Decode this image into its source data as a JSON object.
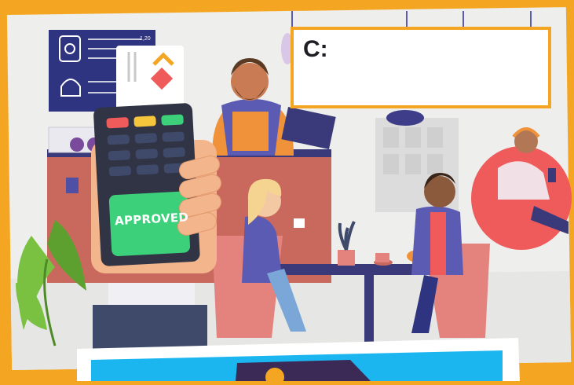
{
  "question_card": {
    "label": "C:"
  },
  "menu_board": {
    "price": "1,20"
  },
  "pos_terminal": {
    "status_text": "APPROVED"
  },
  "colors": {
    "frame": "#f4a623",
    "background": "#eeeeec",
    "counter": "#c9695e",
    "approved_screen": "#3dd07a",
    "bottom_card": "#1bb6f0",
    "chair": "#e4837e",
    "bean_bag": "#ef5b5b"
  }
}
